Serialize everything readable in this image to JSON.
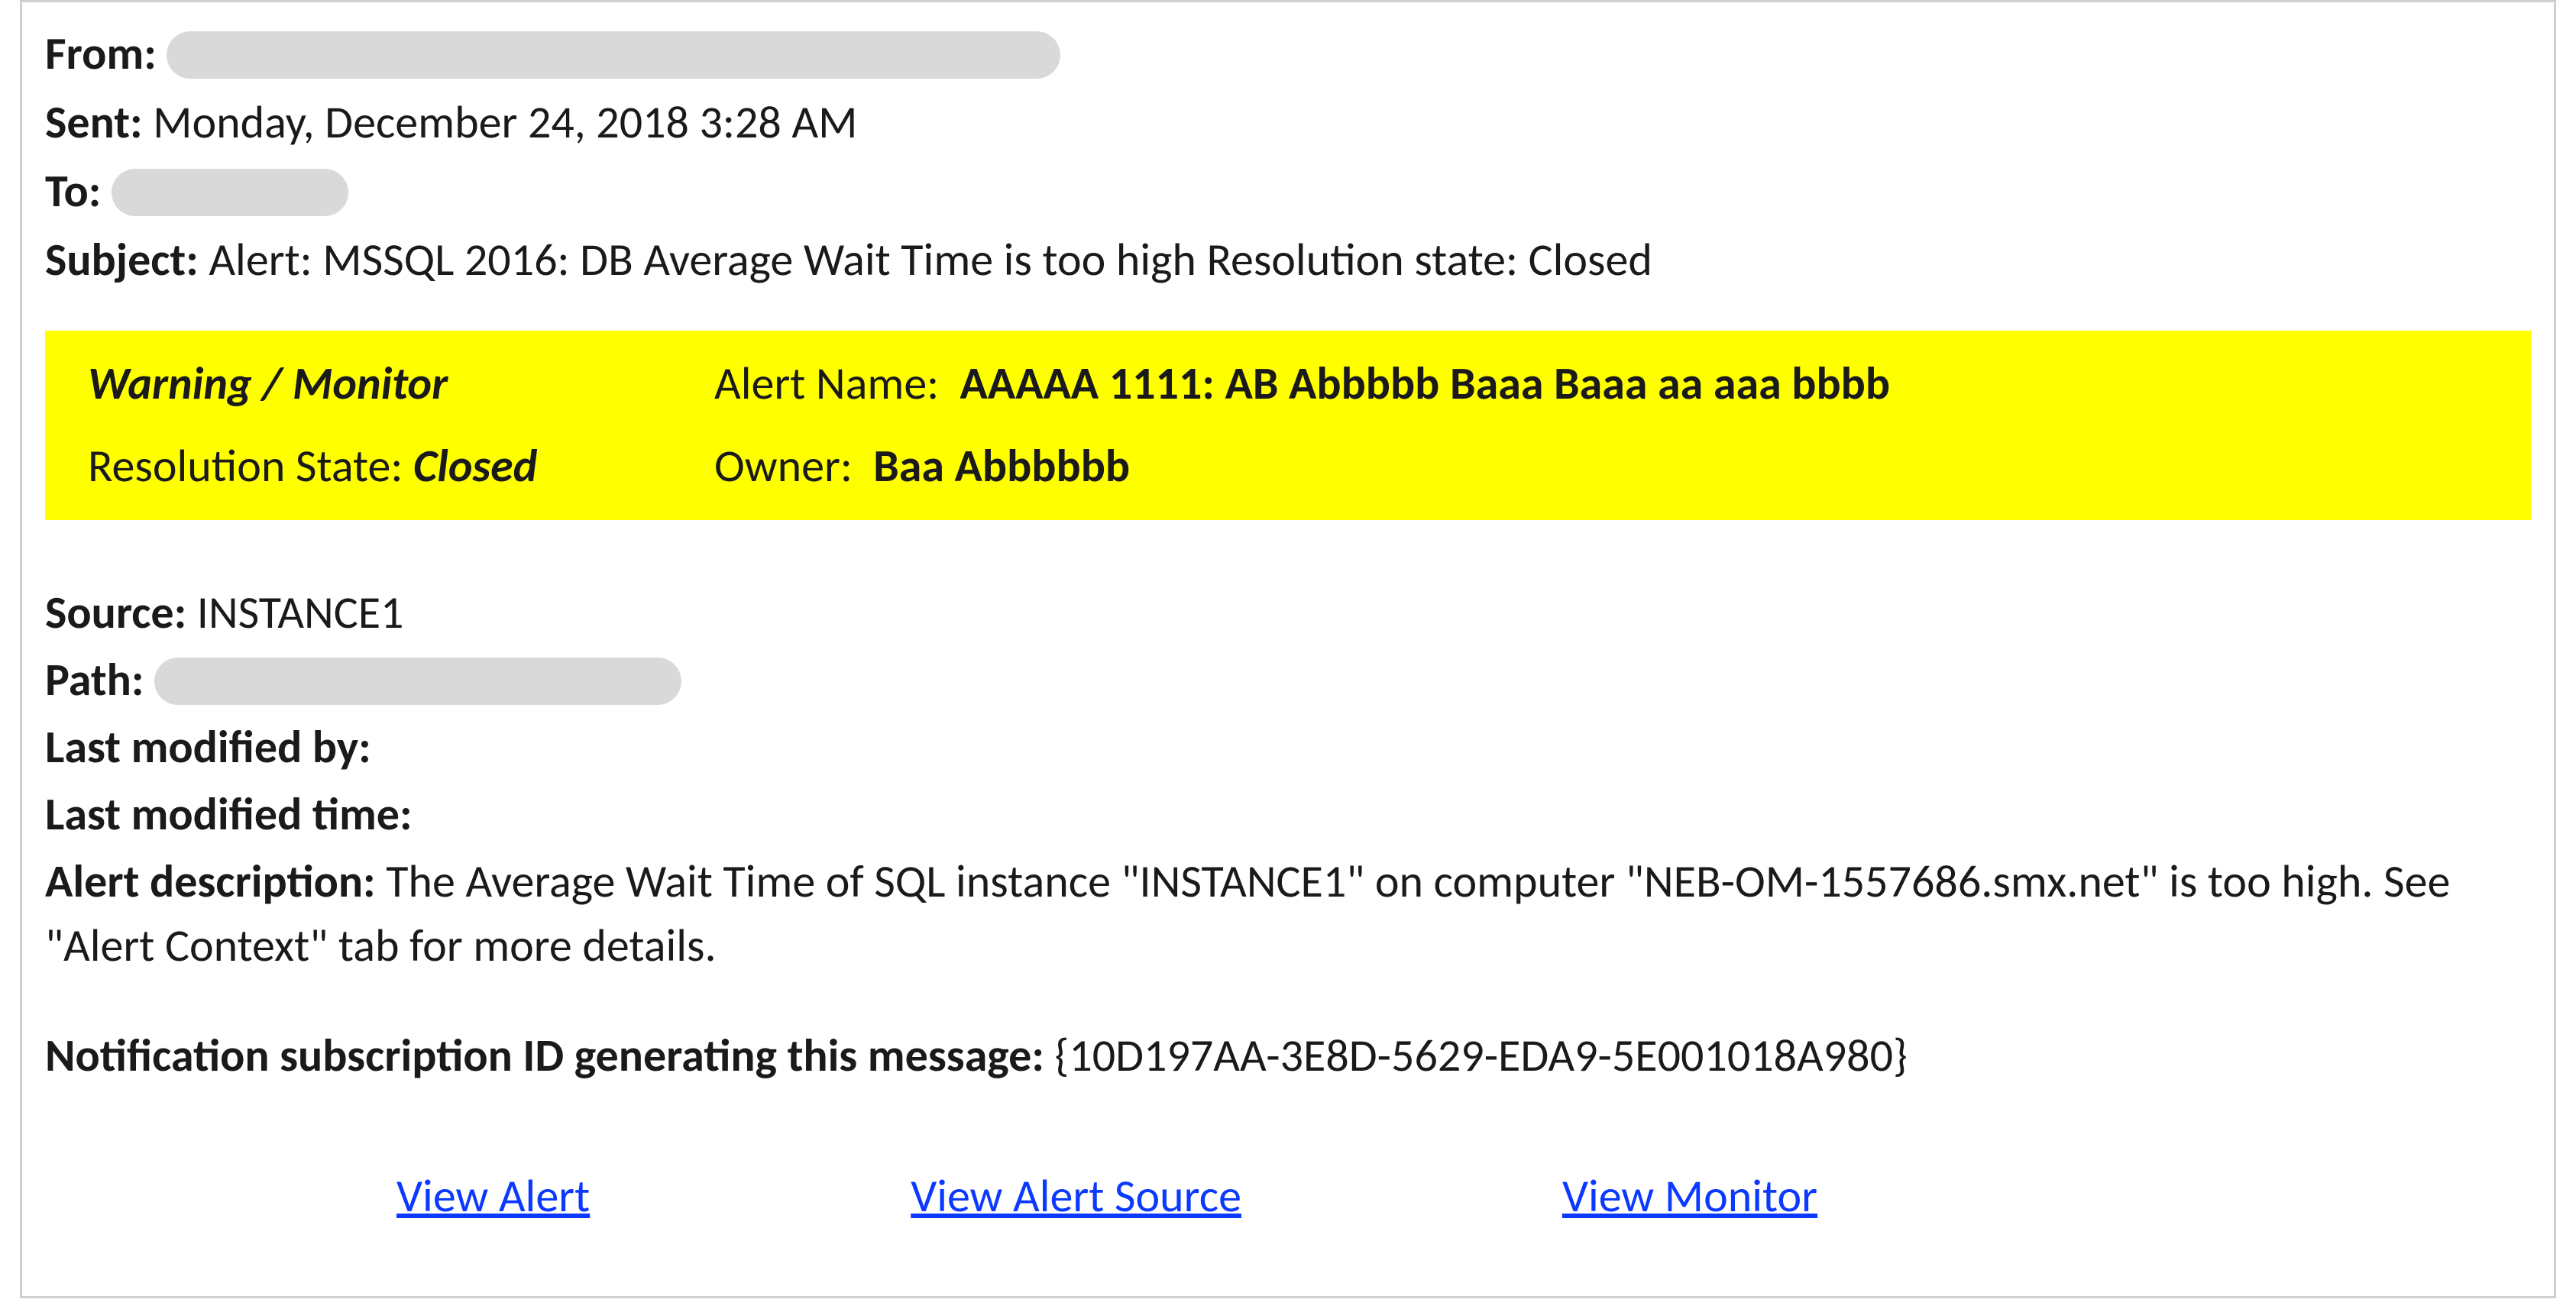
{
  "header": {
    "labels": {
      "from": "From:",
      "sent": "Sent:",
      "to": "To:",
      "subject": "Subject:"
    },
    "sent": "Monday, December 24, 2018 3:28 AM",
    "subject": "Alert: MSSQL 2016: DB Average Wait Time is too high Resolution state: Closed"
  },
  "highlight": {
    "severity": "Warning / Monitor",
    "alert_name_label": "Alert Name:",
    "alert_name_value": "AAAAA 1111: AB Abbbbb Baaa Baaa aa aaa bbbb",
    "resolution_state_label": "Resolution State:",
    "resolution_state_value": "Closed",
    "owner_label": "Owner:",
    "owner_value": "Baa Abbbbbb"
  },
  "details": {
    "source_label": "Source:",
    "source_value": "INSTANCE1",
    "path_label": "Path:",
    "last_modified_by_label": "Last modified by:",
    "last_modified_by_value": "",
    "last_modified_time_label": "Last modified time:",
    "last_modified_time_value": "",
    "alert_description_label": "Alert description:",
    "alert_description_value": "The Average Wait Time of SQL instance \"INSTANCE1\" on computer \"NEB-OM-1557686.smx.net\" is too high. See \"Alert Context\" tab for more details.",
    "subscription_label": "Notification subscription ID generating this message:",
    "subscription_value": "{10D197AA-3E8D-5629-EDA9-5E001018A980}"
  },
  "links": {
    "view_alert": "View Alert",
    "view_alert_source": "View Alert Source",
    "view_monitor": "View Monitor"
  }
}
